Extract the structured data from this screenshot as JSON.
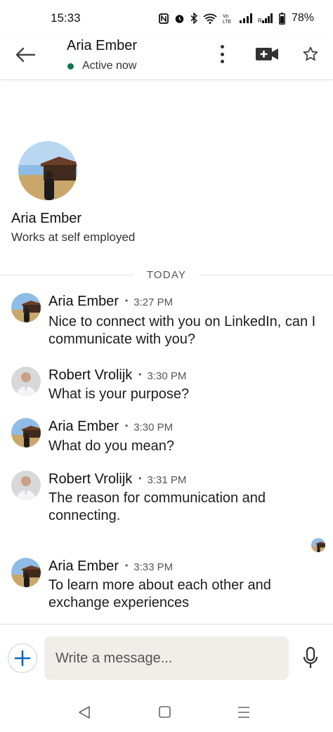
{
  "status_bar": {
    "time": "15:33",
    "battery": "78%",
    "icons": [
      "nfc-icon",
      "alarm-icon",
      "bluetooth-icon",
      "wifi-icon",
      "volte-icon",
      "signal-icon",
      "signal-roaming-icon",
      "battery-icon"
    ]
  },
  "header": {
    "name": "Aria Ember",
    "status": "Active now",
    "status_color": "#0b7a4b"
  },
  "profile": {
    "name": "Aria Ember",
    "subtitle": "Works at self employed"
  },
  "divider": {
    "label": "TODAY"
  },
  "messages": [
    {
      "sender": "Aria Ember",
      "time": "3:27 PM",
      "text": "Nice to connect with you on LinkedIn, can I communicate with you?"
    },
    {
      "sender": "Robert Vrolijk",
      "time": "3:30 PM",
      "text": "What is your purpose?"
    },
    {
      "sender": "Aria Ember",
      "time": "3:30 PM",
      "text": "What do you mean?"
    },
    {
      "sender": "Robert Vrolijk",
      "time": "3:31 PM",
      "text": "The reason for communication and connecting."
    },
    {
      "sender": "Aria Ember",
      "time": "3:33 PM",
      "text": "To learn more about each other and exchange experiences"
    }
  ],
  "composer": {
    "placeholder": "Write a message..."
  },
  "colors": {
    "accent": "#0a66c2",
    "input_bg": "#f1eeea"
  }
}
